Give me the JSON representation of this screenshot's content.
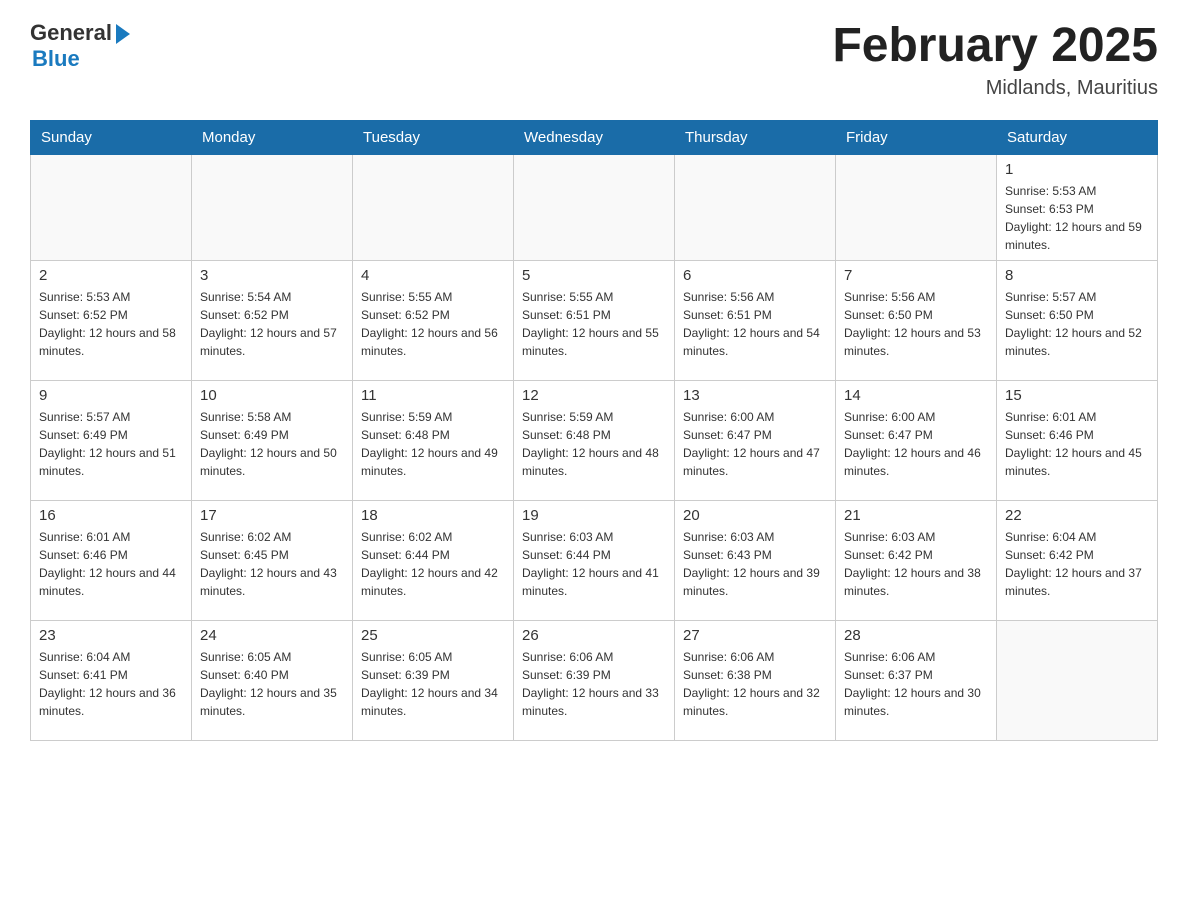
{
  "header": {
    "logo_general": "General",
    "logo_blue": "Blue",
    "title": "February 2025",
    "subtitle": "Midlands, Mauritius"
  },
  "weekdays": [
    "Sunday",
    "Monday",
    "Tuesday",
    "Wednesday",
    "Thursday",
    "Friday",
    "Saturday"
  ],
  "weeks": [
    [
      {
        "day": "",
        "sunrise": "",
        "sunset": "",
        "daylight": ""
      },
      {
        "day": "",
        "sunrise": "",
        "sunset": "",
        "daylight": ""
      },
      {
        "day": "",
        "sunrise": "",
        "sunset": "",
        "daylight": ""
      },
      {
        "day": "",
        "sunrise": "",
        "sunset": "",
        "daylight": ""
      },
      {
        "day": "",
        "sunrise": "",
        "sunset": "",
        "daylight": ""
      },
      {
        "day": "",
        "sunrise": "",
        "sunset": "",
        "daylight": ""
      },
      {
        "day": "1",
        "sunrise": "Sunrise: 5:53 AM",
        "sunset": "Sunset: 6:53 PM",
        "daylight": "Daylight: 12 hours and 59 minutes."
      }
    ],
    [
      {
        "day": "2",
        "sunrise": "Sunrise: 5:53 AM",
        "sunset": "Sunset: 6:52 PM",
        "daylight": "Daylight: 12 hours and 58 minutes."
      },
      {
        "day": "3",
        "sunrise": "Sunrise: 5:54 AM",
        "sunset": "Sunset: 6:52 PM",
        "daylight": "Daylight: 12 hours and 57 minutes."
      },
      {
        "day": "4",
        "sunrise": "Sunrise: 5:55 AM",
        "sunset": "Sunset: 6:52 PM",
        "daylight": "Daylight: 12 hours and 56 minutes."
      },
      {
        "day": "5",
        "sunrise": "Sunrise: 5:55 AM",
        "sunset": "Sunset: 6:51 PM",
        "daylight": "Daylight: 12 hours and 55 minutes."
      },
      {
        "day": "6",
        "sunrise": "Sunrise: 5:56 AM",
        "sunset": "Sunset: 6:51 PM",
        "daylight": "Daylight: 12 hours and 54 minutes."
      },
      {
        "day": "7",
        "sunrise": "Sunrise: 5:56 AM",
        "sunset": "Sunset: 6:50 PM",
        "daylight": "Daylight: 12 hours and 53 minutes."
      },
      {
        "day": "8",
        "sunrise": "Sunrise: 5:57 AM",
        "sunset": "Sunset: 6:50 PM",
        "daylight": "Daylight: 12 hours and 52 minutes."
      }
    ],
    [
      {
        "day": "9",
        "sunrise": "Sunrise: 5:57 AM",
        "sunset": "Sunset: 6:49 PM",
        "daylight": "Daylight: 12 hours and 51 minutes."
      },
      {
        "day": "10",
        "sunrise": "Sunrise: 5:58 AM",
        "sunset": "Sunset: 6:49 PM",
        "daylight": "Daylight: 12 hours and 50 minutes."
      },
      {
        "day": "11",
        "sunrise": "Sunrise: 5:59 AM",
        "sunset": "Sunset: 6:48 PM",
        "daylight": "Daylight: 12 hours and 49 minutes."
      },
      {
        "day": "12",
        "sunrise": "Sunrise: 5:59 AM",
        "sunset": "Sunset: 6:48 PM",
        "daylight": "Daylight: 12 hours and 48 minutes."
      },
      {
        "day": "13",
        "sunrise": "Sunrise: 6:00 AM",
        "sunset": "Sunset: 6:47 PM",
        "daylight": "Daylight: 12 hours and 47 minutes."
      },
      {
        "day": "14",
        "sunrise": "Sunrise: 6:00 AM",
        "sunset": "Sunset: 6:47 PM",
        "daylight": "Daylight: 12 hours and 46 minutes."
      },
      {
        "day": "15",
        "sunrise": "Sunrise: 6:01 AM",
        "sunset": "Sunset: 6:46 PM",
        "daylight": "Daylight: 12 hours and 45 minutes."
      }
    ],
    [
      {
        "day": "16",
        "sunrise": "Sunrise: 6:01 AM",
        "sunset": "Sunset: 6:46 PM",
        "daylight": "Daylight: 12 hours and 44 minutes."
      },
      {
        "day": "17",
        "sunrise": "Sunrise: 6:02 AM",
        "sunset": "Sunset: 6:45 PM",
        "daylight": "Daylight: 12 hours and 43 minutes."
      },
      {
        "day": "18",
        "sunrise": "Sunrise: 6:02 AM",
        "sunset": "Sunset: 6:44 PM",
        "daylight": "Daylight: 12 hours and 42 minutes."
      },
      {
        "day": "19",
        "sunrise": "Sunrise: 6:03 AM",
        "sunset": "Sunset: 6:44 PM",
        "daylight": "Daylight: 12 hours and 41 minutes."
      },
      {
        "day": "20",
        "sunrise": "Sunrise: 6:03 AM",
        "sunset": "Sunset: 6:43 PM",
        "daylight": "Daylight: 12 hours and 39 minutes."
      },
      {
        "day": "21",
        "sunrise": "Sunrise: 6:03 AM",
        "sunset": "Sunset: 6:42 PM",
        "daylight": "Daylight: 12 hours and 38 minutes."
      },
      {
        "day": "22",
        "sunrise": "Sunrise: 6:04 AM",
        "sunset": "Sunset: 6:42 PM",
        "daylight": "Daylight: 12 hours and 37 minutes."
      }
    ],
    [
      {
        "day": "23",
        "sunrise": "Sunrise: 6:04 AM",
        "sunset": "Sunset: 6:41 PM",
        "daylight": "Daylight: 12 hours and 36 minutes."
      },
      {
        "day": "24",
        "sunrise": "Sunrise: 6:05 AM",
        "sunset": "Sunset: 6:40 PM",
        "daylight": "Daylight: 12 hours and 35 minutes."
      },
      {
        "day": "25",
        "sunrise": "Sunrise: 6:05 AM",
        "sunset": "Sunset: 6:39 PM",
        "daylight": "Daylight: 12 hours and 34 minutes."
      },
      {
        "day": "26",
        "sunrise": "Sunrise: 6:06 AM",
        "sunset": "Sunset: 6:39 PM",
        "daylight": "Daylight: 12 hours and 33 minutes."
      },
      {
        "day": "27",
        "sunrise": "Sunrise: 6:06 AM",
        "sunset": "Sunset: 6:38 PM",
        "daylight": "Daylight: 12 hours and 32 minutes."
      },
      {
        "day": "28",
        "sunrise": "Sunrise: 6:06 AM",
        "sunset": "Sunset: 6:37 PM",
        "daylight": "Daylight: 12 hours and 30 minutes."
      },
      {
        "day": "",
        "sunrise": "",
        "sunset": "",
        "daylight": ""
      }
    ]
  ]
}
